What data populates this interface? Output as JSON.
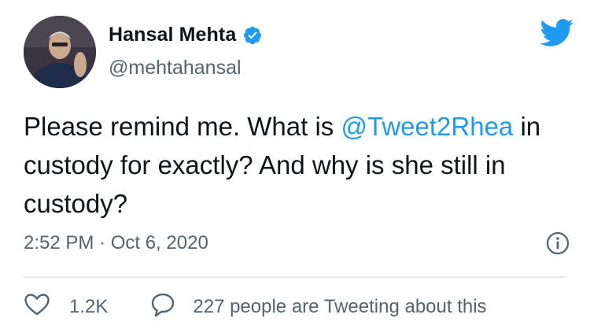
{
  "user": {
    "display_name": "Hansal Mehta",
    "handle": "@mehtahansal",
    "verified": true
  },
  "tweet": {
    "text_part1": "Please remind me. What is ",
    "mention": "@Tweet2Rhea",
    "text_part2": " in custody for exactly? And why is she still in custody?"
  },
  "meta": {
    "timestamp": "2:52 PM · Oct 6, 2020"
  },
  "actions": {
    "like_count": "1.2K",
    "reply_text": "227 people are Tweeting about this"
  },
  "icons": {
    "brand": "twitter-bird-icon",
    "verified": "verified-badge-icon",
    "info": "info-icon",
    "like": "heart-icon",
    "reply": "speech-bubble-icon"
  },
  "colors": {
    "accent": "#1d9bf0",
    "text": "#0f1419",
    "secondary": "#536471"
  }
}
